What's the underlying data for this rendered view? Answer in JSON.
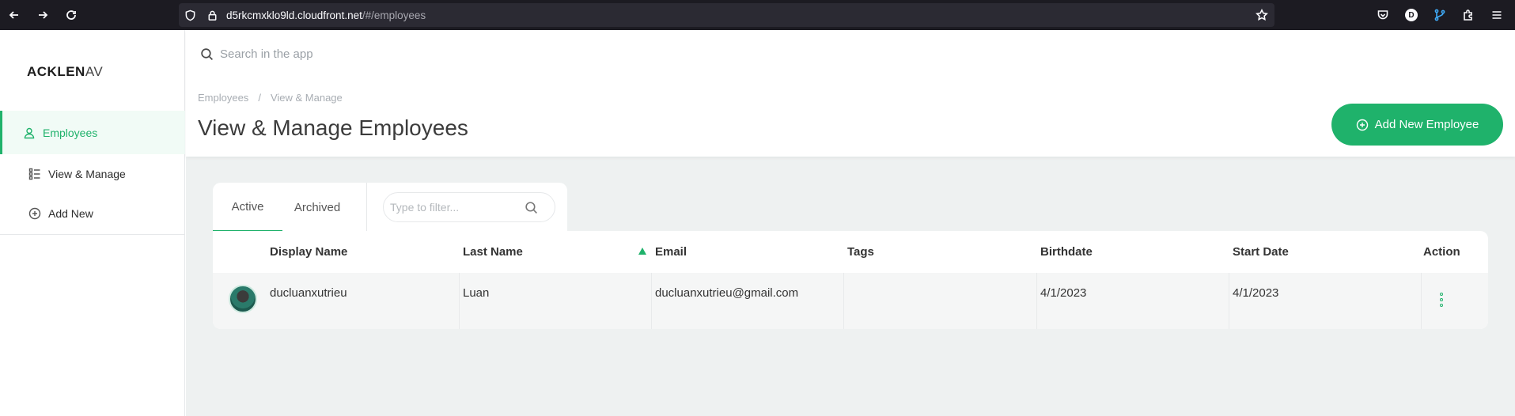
{
  "browser": {
    "url_host": "d5rkcmxklo9ld.cloudfront.net",
    "url_path": "/#/employees",
    "profile_initial": "D"
  },
  "sidebar": {
    "logo_bold": "ACKLEN",
    "logo_thin": "AV",
    "items": [
      {
        "label": "Employees",
        "icon": "user-icon"
      },
      {
        "label": "View & Manage",
        "icon": "list-icon"
      },
      {
        "label": "Add New",
        "icon": "plus-circle-icon"
      }
    ]
  },
  "header": {
    "search_placeholder": "Search in the app",
    "breadcrumb": [
      "Employees",
      "/",
      "View & Manage"
    ],
    "title": "View & Manage Employees",
    "add_button_label": "Add New Employee"
  },
  "tabs": {
    "items": [
      "Active",
      "Archived"
    ],
    "active": "Active",
    "filter_placeholder": "Type to filter..."
  },
  "table": {
    "columns": [
      "Display Name",
      "Last Name",
      "Email",
      "Tags",
      "Birthdate",
      "Start Date",
      "Action"
    ],
    "sorted_column": "Email",
    "sort_direction": "ascending",
    "rows": [
      {
        "display_name": "ducluanxutrieu",
        "last_name": "Luan",
        "email": "ducluanxutrieu@gmail.com",
        "tags": "",
        "birthdate": "4/1/2023",
        "start_date": "4/1/2023"
      }
    ]
  },
  "colors": {
    "accent": "#1fb26b",
    "browser_bg": "#1c1b22",
    "main_bg": "#eef1f1"
  }
}
